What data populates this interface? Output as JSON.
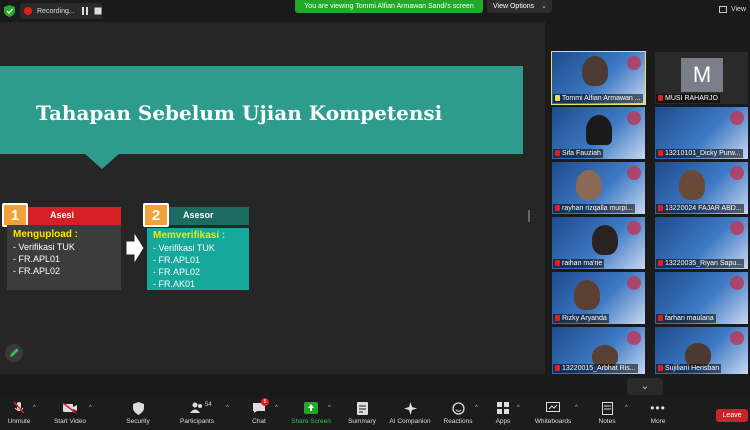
{
  "topbar": {
    "recording_label": "Recording...",
    "viewing_banner": "You are viewing Tommi Alfian Armawan Sandi's screen",
    "view_options_label": "View Options",
    "view_label": "View"
  },
  "slide": {
    "title": "Tahapan Sebelum Ujian Kompetensi",
    "card1": {
      "number": "1",
      "title": "Asesi",
      "lead": "Mengupload :",
      "items": [
        "-   Verifikasi TUK",
        "-   FR.APL01",
        "-   FR.APL02"
      ]
    },
    "card2": {
      "number": "2",
      "title": "Asesor",
      "lead": "Memverifikasi :",
      "items": [
        "-   Verifikasi TUK",
        "-   FR.APL01",
        "-   FR.APL02",
        "-   FR.AK01"
      ]
    }
  },
  "participants": [
    {
      "name": "Tommi Alfian Armawan ..."
    },
    {
      "name": "MUSI RAHARJO",
      "avatar_letter": "M"
    },
    {
      "name": "Sifa Fauziah"
    },
    {
      "name": "13210101_Dicky Purw..."
    },
    {
      "name": "rayhan rizqalla murpi..."
    },
    {
      "name": "13220024 FAJAR ABD..."
    },
    {
      "name": "raihan ma'rie"
    },
    {
      "name": "13220035_Riyan Sapu..."
    },
    {
      "name": "Rizky Aryanda"
    },
    {
      "name": "farhan maulana"
    },
    {
      "name": "13220015_Arbhat Ris..."
    },
    {
      "name": "Sujiliani Herisban"
    }
  ],
  "toolbar": {
    "unmute": "Unmute",
    "start_video": "Start Video",
    "security": "Security",
    "participants": "Participants",
    "participants_count": "54",
    "chat": "Chat",
    "chat_badge": "5",
    "share_screen": "Share Screen",
    "summary": "Summary",
    "ai_companion": "AI Companion",
    "reactions": "Reactions",
    "apps": "Apps",
    "whiteboards": "Whiteboards",
    "notes": "Notes",
    "more": "More",
    "leave": "Leave"
  },
  "colors": {
    "title_band": "#2d9c8f",
    "card1_header": "#d71f26",
    "card2_header": "#1d6c62",
    "card2_body": "#16a89a",
    "number_badge": "#f2a23a",
    "banner_green": "#23a829",
    "leave_red": "#c9242b"
  }
}
